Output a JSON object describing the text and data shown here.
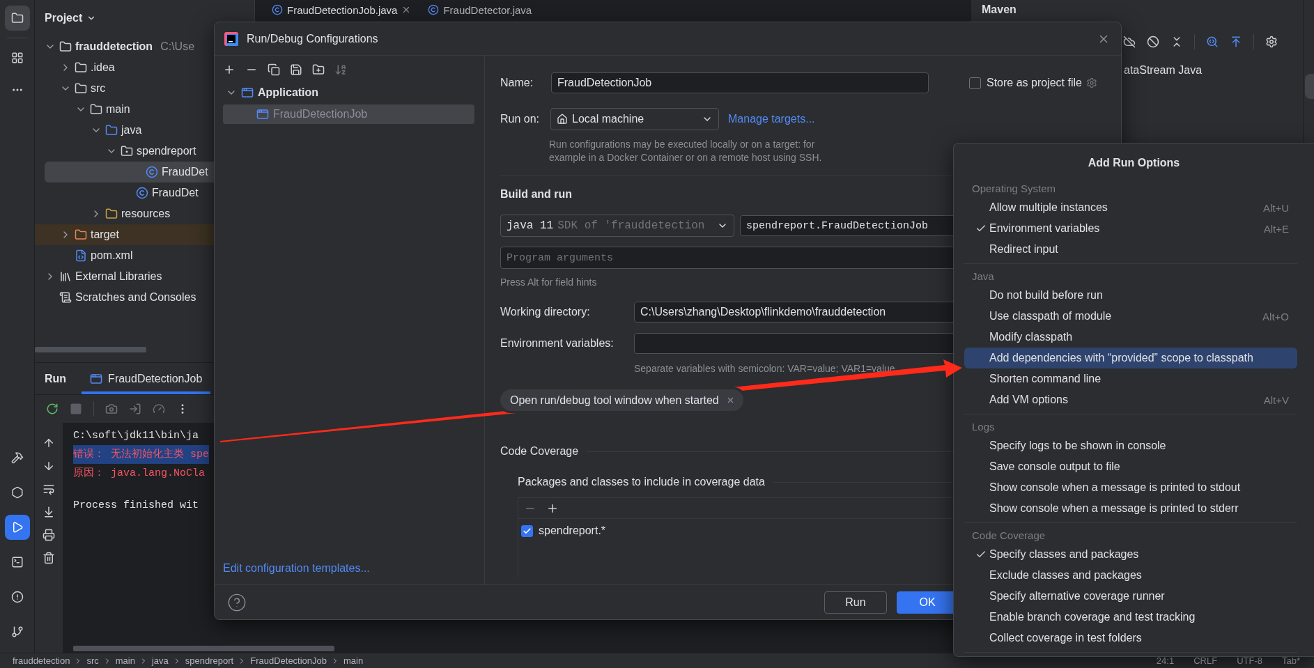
{
  "project_panel": {
    "title": "Project",
    "tree": [
      {
        "label": "frauddetection",
        "path": "C:\\Use",
        "kind": "module",
        "expanded": true,
        "selected": false,
        "children": [
          {
            "label": ".idea",
            "kind": "folder",
            "expanded": false,
            "selected": false
          },
          {
            "label": "src",
            "kind": "folder",
            "expanded": true,
            "selected": false,
            "children": [
              {
                "label": "main",
                "kind": "folder",
                "expanded": true,
                "selected": false,
                "children": [
                  {
                    "label": "java",
                    "kind": "source-folder",
                    "expanded": true,
                    "selected": false,
                    "children": [
                      {
                        "label": "spendreport",
                        "kind": "package",
                        "expanded": true,
                        "selected": false,
                        "children": [
                          {
                            "label": "FraudDet",
                            "kind": "class",
                            "selected": true
                          },
                          {
                            "label": "FraudDet",
                            "kind": "class",
                            "selected": false
                          }
                        ]
                      }
                    ]
                  },
                  {
                    "label": "resources",
                    "kind": "resources-folder",
                    "expanded": false,
                    "selected": false
                  }
                ]
              }
            ]
          },
          {
            "label": "target",
            "kind": "excluded-folder",
            "expanded": false,
            "selected": false
          },
          {
            "label": "pom.xml",
            "kind": "maven",
            "selected": false
          }
        ]
      },
      {
        "label": "External Libraries",
        "kind": "library",
        "expanded": false,
        "selected": false
      },
      {
        "label": "Scratches and Consoles",
        "kind": "scratches",
        "selected": false
      }
    ]
  },
  "editor_tabs": [
    {
      "label": "FraudDetectionJob.java",
      "selected": true
    },
    {
      "label": "FraudDetector.java",
      "selected": false
    }
  ],
  "maven_panel": {
    "title": "Maven",
    "tree_item": "ataStream Java"
  },
  "run_panel": {
    "title": "Run",
    "tabs": [
      {
        "label": "FraudDetectionJob",
        "selected": true
      }
    ],
    "console": [
      {
        "text": "C:\\soft\\jdk11\\bin\\ja",
        "kind": "command",
        "selected": false
      },
      {
        "text": "错误： 无法初始化主类 spe",
        "kind": "error",
        "selected": true
      },
      {
        "text": "原因： java.lang.NoCla",
        "kind": "error",
        "selected": false
      },
      {
        "text": "Process finished wit",
        "kind": "exit",
        "selected": false
      }
    ]
  },
  "dialog": {
    "title": "Run/Debug Configurations",
    "tree": [
      {
        "label": "Application",
        "expanded": true,
        "selected": false,
        "children": [
          {
            "label": "FraudDetectionJob",
            "selected": true
          }
        ]
      }
    ],
    "edit_templates_link": "Edit configuration templates...",
    "name": {
      "label": "Name:",
      "value": "FraudDetectionJob"
    },
    "store_as_project_file": {
      "label": "Store as project file",
      "checked": false
    },
    "run_on": {
      "label": "Run on:",
      "value": "Local machine",
      "link": "Manage targets...",
      "hint": "Run configurations may be executed locally or on a target: for example in a Docker Container or on a remote host using SSH."
    },
    "build_and_run": {
      "title": "Build and run",
      "jre": {
        "value": "java 11",
        "detail": "SDK of 'frauddetection"
      },
      "main_class": "spendreport.FraudDetectionJob",
      "program_arguments": {
        "placeholder": "Program arguments"
      },
      "hint": "Press Alt for field hints"
    },
    "working_directory": {
      "label": "Working directory:",
      "value": "C:\\Users\\zhang\\Desktop\\flinkdemo\\frauddetection"
    },
    "environment_variables": {
      "label": "Environment variables:",
      "hint": "Separate variables with semicolon: VAR=value; VAR1=value"
    },
    "options": [
      {
        "label": "Open run/debug tool window when started"
      }
    ],
    "code_coverage": {
      "title": "Code Coverage",
      "subtitle": "Packages and classes to include in coverage data",
      "entries": [
        {
          "label": "spendreport.*",
          "checked": true
        }
      ]
    },
    "buttons": [
      {
        "label": "Run",
        "kind": "secondary"
      },
      {
        "label": "OK",
        "kind": "primary"
      }
    ]
  },
  "popup": {
    "title": "Add Run Options",
    "sections": [
      {
        "title": "Operating System",
        "items": [
          {
            "label": "Allow multiple instances",
            "shortcut": "Alt+U",
            "checked": false,
            "selected": false
          },
          {
            "label": "Environment variables",
            "shortcut": "Alt+E",
            "checked": true,
            "selected": false
          },
          {
            "label": "Redirect input",
            "checked": false,
            "selected": false
          }
        ]
      },
      {
        "title": "Java",
        "items": [
          {
            "label": "Do not build before run",
            "checked": false,
            "selected": false
          },
          {
            "label": "Use classpath of module",
            "shortcut": "Alt+O",
            "checked": false,
            "selected": false
          },
          {
            "label": "Modify classpath",
            "checked": false,
            "selected": false
          },
          {
            "label": "Add dependencies with “provided” scope to classpath",
            "checked": false,
            "selected": true
          },
          {
            "label": "Shorten command line",
            "checked": false,
            "selected": false
          },
          {
            "label": "Add VM options",
            "shortcut": "Alt+V",
            "checked": false,
            "selected": false
          }
        ]
      },
      {
        "title": "Logs",
        "items": [
          {
            "label": "Specify logs to be shown in console",
            "checked": false,
            "selected": false
          },
          {
            "label": "Save console output to file",
            "checked": false,
            "selected": false
          },
          {
            "label": "Show console when a message is printed to stdout",
            "checked": false,
            "selected": false
          },
          {
            "label": "Show console when a message is printed to stderr",
            "checked": false,
            "selected": false
          }
        ]
      },
      {
        "title": "Code Coverage",
        "items": [
          {
            "label": "Specify classes and packages",
            "checked": true,
            "selected": false
          },
          {
            "label": "Exclude classes and packages",
            "checked": false,
            "selected": false
          },
          {
            "label": "Specify alternative coverage runner",
            "checked": false,
            "selected": false
          },
          {
            "label": "Enable branch coverage and test tracking",
            "checked": false,
            "selected": false
          },
          {
            "label": "Collect coverage in test folders",
            "checked": false,
            "selected": false
          }
        ]
      }
    ]
  },
  "status_bar": {
    "breadcrumbs": [
      "frauddetection",
      "src",
      "main",
      "java",
      "spendreport",
      "FraudDetectionJob",
      "main"
    ],
    "items": [
      "24:1",
      "CRLF",
      "UTF-8",
      "Tab*"
    ]
  }
}
